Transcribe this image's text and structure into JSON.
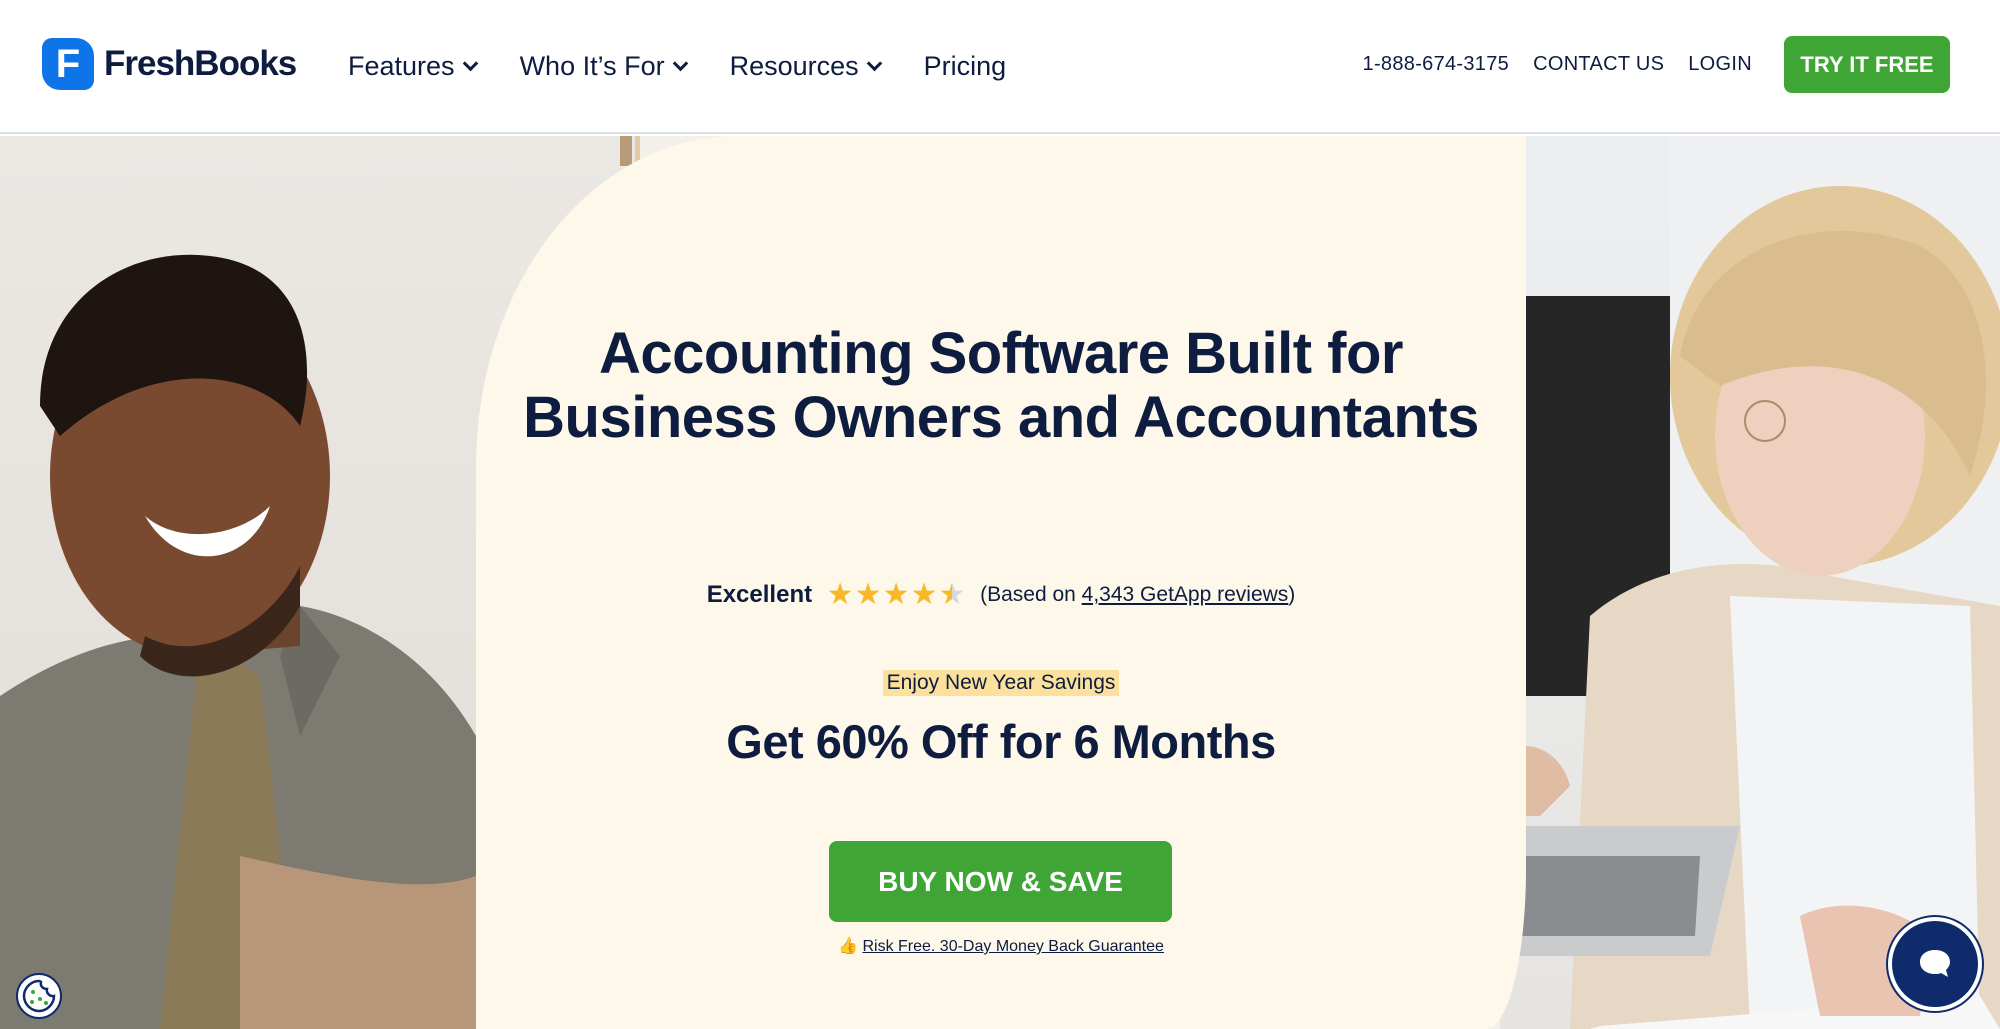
{
  "header": {
    "logo_mark": "F",
    "logo_text": "FreshBooks",
    "nav": [
      {
        "label": "Features",
        "has_dropdown": true
      },
      {
        "label": "Who It’s For",
        "has_dropdown": true
      },
      {
        "label": "Resources",
        "has_dropdown": true
      },
      {
        "label": "Pricing",
        "has_dropdown": false
      }
    ],
    "phone": "1-888-674-3175",
    "contact": "CONTACT US",
    "login": "LOGIN",
    "cta": "TRY IT FREE"
  },
  "hero": {
    "headline": "Accounting Software Built for Business Owners and Accountants",
    "rating_label": "Excellent",
    "rating_stars": 4.5,
    "reviews_prefix": "(Based on ",
    "reviews_link": "4,343 GetApp reviews",
    "reviews_suffix": ")",
    "promo_tag": "Enjoy New Year Savings",
    "offer": "Get 60% Off for 6 Months",
    "buy_button": "BUY NOW & SAVE",
    "guarantee_icon": "👍",
    "guarantee": "Risk Free. 30-Day Money Back Guarantee"
  },
  "colors": {
    "brand_blue": "#0e75e8",
    "navy": "#0d1c3f",
    "green": "#3fa535",
    "cream": "#fdf8ea",
    "highlight": "#fbe19b",
    "star": "#f7b928"
  },
  "icons": [
    "freshbooks-logo-icon",
    "chevron-down-icon",
    "star-icon",
    "thumbs-up-icon",
    "chat-icon",
    "cookie-icon"
  ]
}
